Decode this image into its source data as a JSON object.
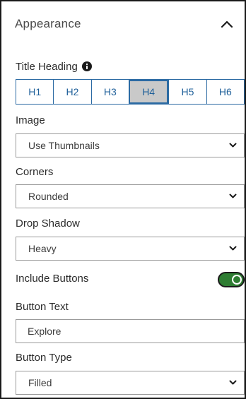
{
  "header": {
    "title": "Appearance",
    "collapse_icon": "chevron-up-icon"
  },
  "title_heading": {
    "label": "Title Heading",
    "info_icon": "info-icon",
    "options": [
      "H1",
      "H2",
      "H3",
      "H4",
      "H5",
      "H6"
    ],
    "selected": "H4"
  },
  "image": {
    "label": "Image",
    "value": "Use Thumbnails"
  },
  "corners": {
    "label": "Corners",
    "value": "Rounded"
  },
  "drop_shadow": {
    "label": "Drop Shadow",
    "value": "Heavy"
  },
  "include_buttons": {
    "label": "Include Buttons",
    "enabled": true
  },
  "button_text": {
    "label": "Button Text",
    "value": "Explore"
  },
  "button_type": {
    "label": "Button Type",
    "value": "Filled"
  },
  "colors": {
    "accent": "#2b6aa3",
    "toggle_on": "#2e7d32",
    "selected_bg": "#c9c9c9"
  }
}
